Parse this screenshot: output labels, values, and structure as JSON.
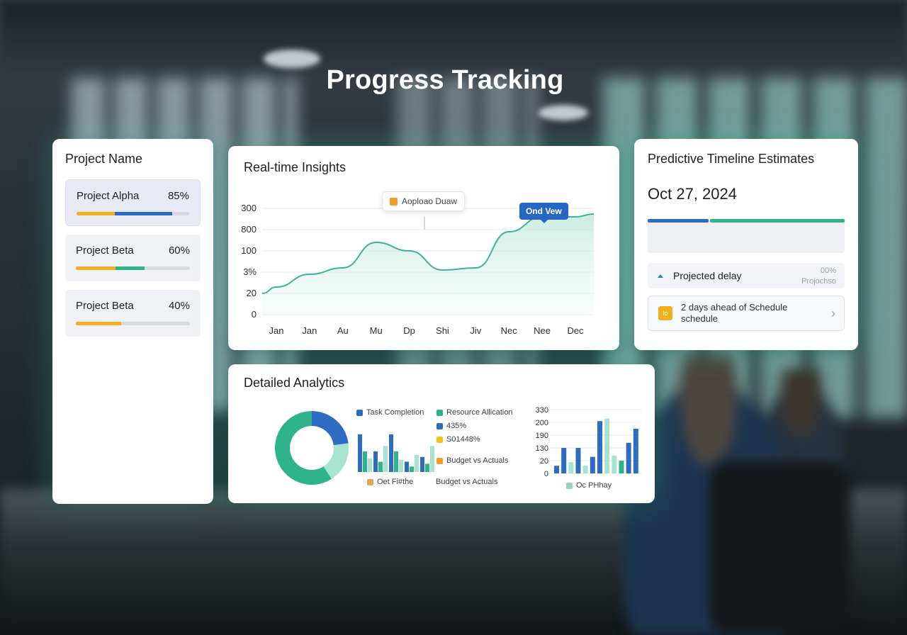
{
  "page_title": "Progress Tracking",
  "colors": {
    "accent_blue": "#2e6bc2",
    "accent_green": "#2eb38b",
    "accent_teal_light": "#a7e3cf",
    "accent_yellow": "#f2b01e",
    "accent_orange": "#f39c29",
    "glow": "#38d7b4"
  },
  "projects": {
    "title": "Project Name",
    "items": [
      {
        "name": "Project Alpha",
        "percent_label": "85%",
        "progress": 0.85,
        "segments": [
          {
            "color": "#f2b01e",
            "share": 0.34
          },
          {
            "color": "#2e6bc2",
            "share": 0.51
          }
        ]
      },
      {
        "name": "Project Beta",
        "percent_label": "60%",
        "progress": 0.6,
        "segments": [
          {
            "color": "#f2b01e",
            "share": 0.35
          },
          {
            "color": "#2eb38b",
            "share": 0.25
          }
        ]
      },
      {
        "name": "Project Beta",
        "percent_label": "40%",
        "progress": 0.4,
        "segments": [
          {
            "color": "#f2b01e",
            "share": 0.4
          }
        ]
      }
    ]
  },
  "insights": {
    "title": "Real-time Insights",
    "tooltip_label": "Aoploao Duaw",
    "tooltip_icon": "square-icon",
    "badge_label": "Ond Vew",
    "chart_data": {
      "type": "area",
      "y_tick_labels": [
        "300",
        "800",
        "100",
        "3%",
        "20",
        "0"
      ],
      "x_tick_labels": [
        "Jan",
        "Jan",
        "Au",
        "Mu",
        "Dp",
        "Shi",
        "Jiv",
        "Nec",
        "Nee",
        "Dec"
      ],
      "series": [
        {
          "values": [
            1.3,
            1.9,
            2.2,
            3.4,
            3.0,
            2.1,
            2.2,
            3.9,
            4.6,
            4.6
          ]
        }
      ],
      "ylim": [
        0,
        5
      ],
      "grid": true
    }
  },
  "predictive": {
    "title": "Predictive Timeline Estimates",
    "date": "Oct 27, 2024",
    "delay_label": "Projected delay",
    "delay_pct": "00%",
    "delay_sub": "Projochso",
    "ahead_icon_text": "lo",
    "ahead_line1": "2 days ahead of Schedule",
    "ahead_line2": "schedule",
    "chevron_icon": "chevron-right-icon"
  },
  "analytics": {
    "title": "Detailed Analytics",
    "legend": {
      "task_completion": "Task Completion",
      "resource_allocation": "Resource Allication",
      "pct_a": "435%",
      "pct_b": "S01448%",
      "budget_vs_actuals": "Budget vs Actuals",
      "oet_phttie": "Oet Fi#the",
      "budget_vs_actuals_2": "Budget vs Actuals",
      "oc_phhay": "Oc PHhay"
    },
    "chart_data": [
      {
        "type": "pie",
        "slices": [
          {
            "color": "#2e6bc2",
            "value": 0.23
          },
          {
            "color": "#a7e3cf",
            "value": 0.18
          },
          {
            "color": "#2eb38b",
            "value": 0.59
          }
        ]
      },
      {
        "type": "bar",
        "series": [
          {
            "values": [
              55,
              30,
              55,
              15,
              22
            ]
          },
          {
            "values": [
              30,
              15,
              30,
              8,
              12
            ]
          },
          {
            "values": [
              20,
              38,
              18,
              25,
              38
            ]
          }
        ]
      },
      {
        "type": "bar",
        "y_tick_labels": [
          "330",
          "200",
          "190",
          "130",
          "20",
          "0"
        ],
        "values": [
          12,
          40,
          18,
          40,
          12,
          26,
          82,
          86,
          28,
          20,
          48,
          70
        ],
        "colors": [
          "#2e6bc2",
          "#2e6bc2",
          "#a7e3cf",
          "#2e6bc2",
          "#a7e3cf",
          "#2e6bc2",
          "#2e6bc2",
          "#a7e3cf",
          "#a7e3cf",
          "#2eb38b",
          "#2e6bc2",
          "#2e6bc2"
        ],
        "ylim": [
          0,
          100
        ]
      }
    ]
  }
}
